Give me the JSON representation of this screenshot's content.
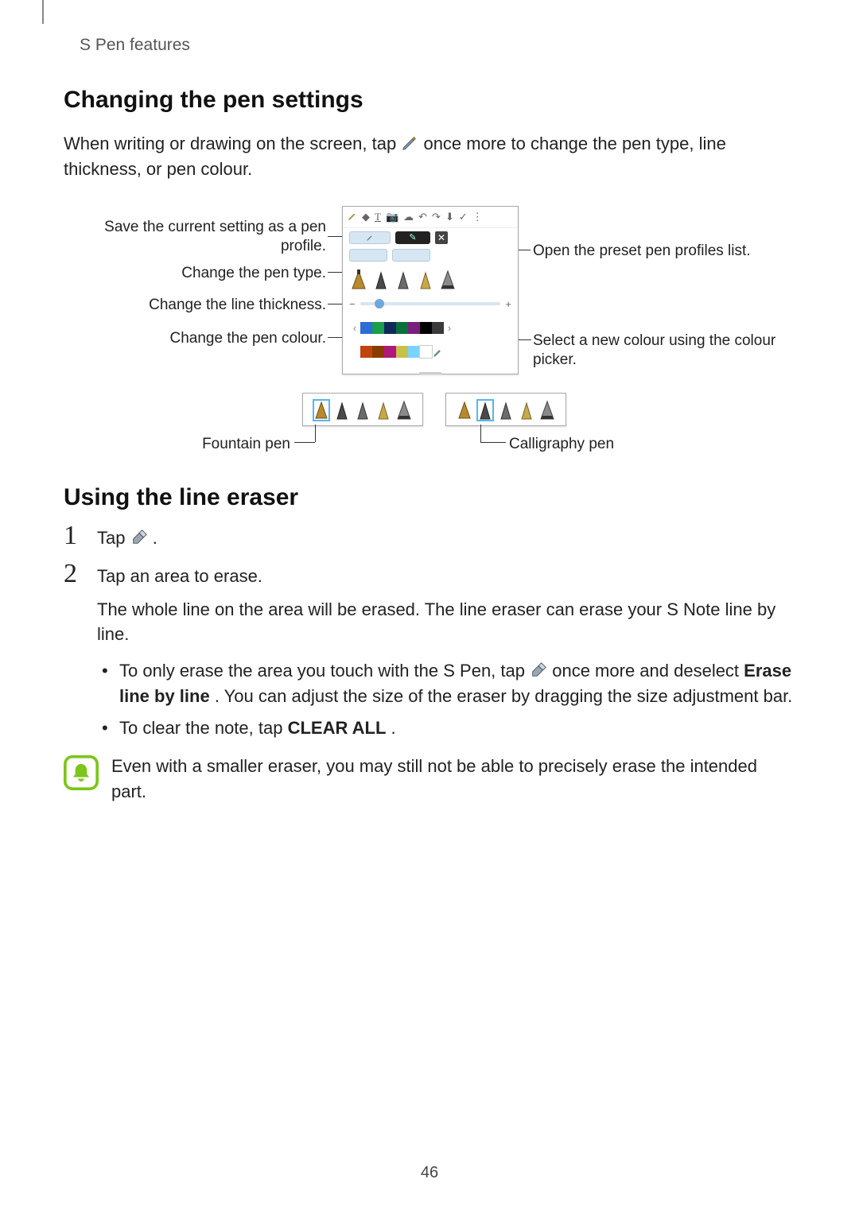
{
  "breadcrumb": "S Pen features",
  "section1": {
    "heading": "Changing the pen settings",
    "para_a": "When writing or drawing on the screen, tap ",
    "para_b": " once more to change the pen type, line thickness, or pen colour."
  },
  "callouts": {
    "save_profile": "Save the current setting as a pen profile.",
    "pen_type": "Change the pen type.",
    "line_thickness": "Change the line thickness.",
    "pen_colour": "Change the pen colour.",
    "preset_list": "Open the preset pen profiles list.",
    "colour_picker": "Select a new colour using the colour picker.",
    "fountain": "Fountain pen",
    "calligraphy": "Calligraphy pen"
  },
  "swatches_row1": [
    "#2e6bd6",
    "#1a9e4b",
    "#0f2a5a",
    "#0a7039",
    "#7a1f7d",
    "#000000",
    "#3a3a3a"
  ],
  "swatches_row2": [
    "#c1440e",
    "#8a3b00",
    "#b0187c",
    "#c9c04a",
    "#79d2ff",
    "#ffffff"
  ],
  "section2": {
    "heading": "Using the line eraser"
  },
  "steps": {
    "s1_a": "Tap ",
    "s1_b": ".",
    "s2_a": "Tap an area to erase.",
    "s2_b": "The whole line on the area will be erased. The line eraser can erase your S Note line by line.",
    "b1_a": "To only erase the area you touch with the S Pen, tap ",
    "b1_b": " once more and deselect ",
    "b1_bold": "Erase line by line",
    "b1_c": ". You can adjust the size of the eraser by dragging the size adjustment bar.",
    "b2_a": "To clear the note, tap ",
    "b2_bold": "CLEAR ALL",
    "b2_b": "."
  },
  "tip": "Even with a smaller eraser, you may still not be able to precisely erase the intended part.",
  "page_number": "46"
}
